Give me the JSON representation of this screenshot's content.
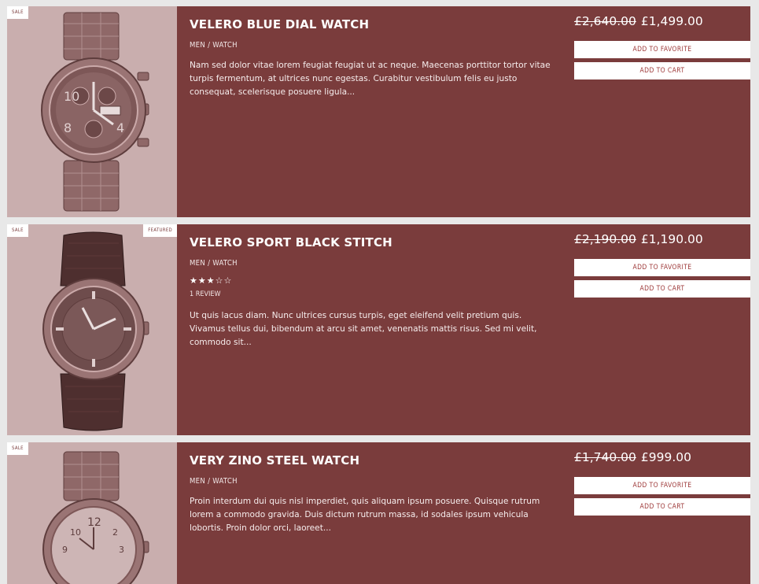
{
  "products": [
    {
      "badges": [
        "SALE"
      ],
      "title": "VELERO BLUE DIAL WATCH",
      "category": "MEN / WATCH",
      "old_price": "£2,640.00",
      "price": "£1,499.00",
      "description": "Nam sed dolor vitae lorem feugiat feugiat ut ac neque. Maecenas porttitor tortor vitae turpis fermentum, at ultrices nunc egestas. Curabitur vestibulum felis eu justo consequat, scelerisque posuere ligula...",
      "add_favorite": "ADD TO FAVORITE",
      "add_cart": "ADD TO CART",
      "image_icon": "chronograph-watch-steel-bracelet"
    },
    {
      "badges": [
        "SALE",
        "FEATURED"
      ],
      "title": "VELERO SPORT BLACK STITCH",
      "category": "MEN / WATCH",
      "rating": 3,
      "rating_max": 5,
      "stars": "★★★☆☆",
      "reviews": "1 REVIEW",
      "old_price": "£2,190.00",
      "price": "£1,190.00",
      "description": "Ut quis lacus diam. Nunc ultrices cursus turpis, eget eleifend velit pretium quis. Vivamus tellus dui, bibendum at arcu sit amet, venenatis mattis risus. Sed mi velit, commodo sit...",
      "add_favorite": "ADD TO FAVORITE",
      "add_cart": "ADD TO CART",
      "image_icon": "leather-strap-watch"
    },
    {
      "badges": [
        "SALE"
      ],
      "title": "VERY ZINO STEEL WATCH",
      "category": "MEN / WATCH",
      "old_price": "£1,740.00",
      "price": "£999.00",
      "description": "Proin interdum dui quis nisl imperdiet, quis aliquam ipsum posuere. Quisque rutrum lorem a commodo gravida. Duis dictum rutrum massa, id sodales ipsum vehicula lobortis. Proin dolor orci, laoreet...",
      "add_favorite": "ADD TO FAVORITE",
      "add_cart": "ADD TO CART",
      "image_icon": "steel-dress-watch"
    }
  ],
  "colors": {
    "card_bg": "#7a3c3c",
    "thumb_bg": "#c9aeae",
    "button_text": "#9e3a3a",
    "page_bg": "#e8e8e8"
  }
}
